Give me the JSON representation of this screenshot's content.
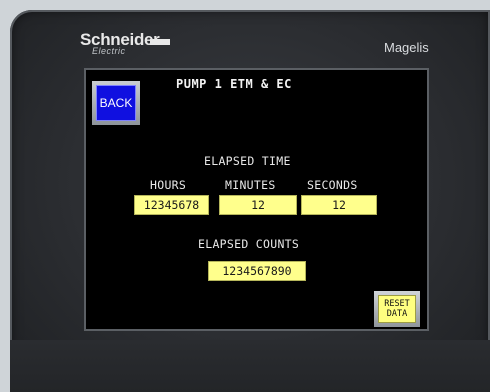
{
  "device": {
    "brand": "Schneider",
    "brand_sub": "Electric",
    "model": "Magelis"
  },
  "screen": {
    "title": "PUMP 1 ETM & EC",
    "back_label": "BACK",
    "elapsed_time_label": "ELAPSED TIME",
    "hours_label": "HOURS",
    "minutes_label": "MINUTES",
    "seconds_label": "SECONDS",
    "hours_value": "12345678",
    "minutes_value": "12",
    "seconds_value": "12",
    "elapsed_counts_label": "ELAPSED COUNTS",
    "counts_value": "1234567890",
    "reset_line1": "RESET",
    "reset_line2": "DATA"
  },
  "colors": {
    "back_button": "#1010e0",
    "field_fill": "#ffff8c",
    "screen_bg": "#000000"
  }
}
